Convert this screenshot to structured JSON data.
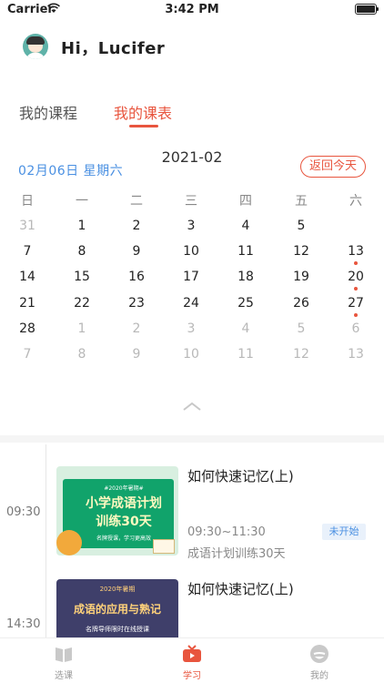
{
  "status_bar": {
    "carrier": "Carrier",
    "time": "3:42 PM"
  },
  "header": {
    "greeting": "Hi，Lucifer"
  },
  "tabs": [
    {
      "label": "我的课程",
      "active": false
    },
    {
      "label": "我的课表",
      "active": true
    }
  ],
  "calendar": {
    "month": "2021-02",
    "selected_date": "02月06日 星期六",
    "today_button": "返回今天",
    "weekdays": [
      "日",
      "一",
      "二",
      "三",
      "四",
      "五",
      "六"
    ],
    "rows": [
      [
        "31",
        "1",
        "2",
        "3",
        "4",
        "5",
        "6"
      ],
      [
        "7",
        "8",
        "9",
        "10",
        "11",
        "12",
        "13"
      ],
      [
        "14",
        "15",
        "16",
        "17",
        "18",
        "19",
        "20"
      ],
      [
        "21",
        "22",
        "23",
        "24",
        "25",
        "26",
        "27"
      ],
      [
        "28",
        "1",
        "2",
        "3",
        "4",
        "5",
        "6"
      ],
      [
        "7",
        "8",
        "9",
        "10",
        "11",
        "12",
        "13"
      ]
    ],
    "selected_day": "6",
    "days_with_events": [
      "13",
      "20",
      "27"
    ]
  },
  "schedule": [
    {
      "start": "09:30",
      "title": "如何快速记忆(上)",
      "time_range": "09:30~11:30",
      "course": "成语计划训练30天",
      "status": "未开始",
      "thumbnail": {
        "tag": "#2020年暑期#",
        "line1": "小学成语计划",
        "line2": "训练30天",
        "line3": "名牌授课，学习更高效"
      }
    },
    {
      "start": "14:30",
      "title": "如何快速记忆(上)",
      "thumbnail": {
        "tag": "2020年暑期",
        "line1": "成语的应用与熟记",
        "line2": "名牌导师限时在线授课"
      }
    }
  ],
  "tabbar": [
    {
      "label": "选课",
      "icon": "book-icon",
      "active": false
    },
    {
      "label": "学习",
      "icon": "tv-icon",
      "active": true
    },
    {
      "label": "我的",
      "icon": "profile-icon",
      "active": false
    }
  ],
  "colors": {
    "accent": "#e8553e",
    "date_blue": "#4a90e2",
    "selected_bg": "#111111"
  }
}
